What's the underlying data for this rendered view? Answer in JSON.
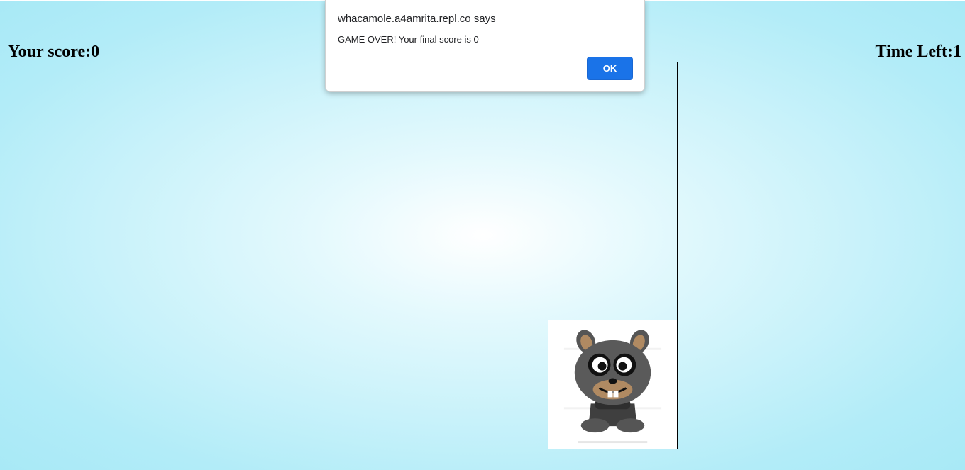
{
  "game": {
    "score_label": "Your score:0",
    "time_label": "Time Left:1",
    "holes": [
      {
        "mole": false
      },
      {
        "mole": false
      },
      {
        "mole": false
      },
      {
        "mole": false
      },
      {
        "mole": false
      },
      {
        "mole": false
      },
      {
        "mole": false
      },
      {
        "mole": false
      },
      {
        "mole": true
      }
    ]
  },
  "alert": {
    "origin": "whacamole.a4amrita.repl.co says",
    "message": "GAME OVER! Your final score is 0",
    "ok_label": "OK"
  },
  "colors": {
    "accent": "#1a73e8",
    "background": "#b2ecf8"
  }
}
